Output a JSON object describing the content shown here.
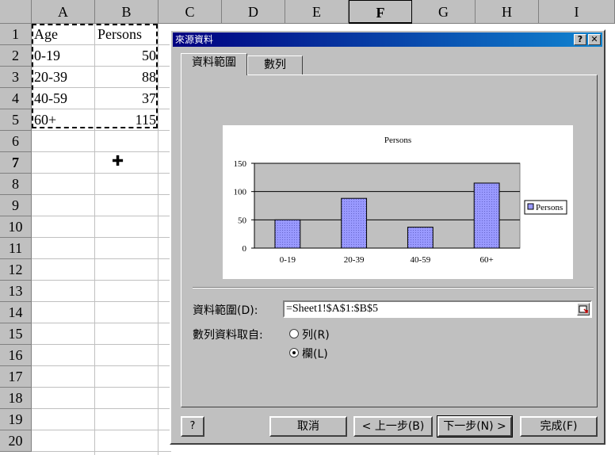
{
  "spreadsheet": {
    "columns": [
      "A",
      "B",
      "C",
      "D",
      "E",
      "F",
      "G",
      "H",
      "I"
    ],
    "active_column": "F",
    "rows": [
      "1",
      "2",
      "3",
      "4",
      "5",
      "6",
      "7",
      "8",
      "9",
      "10",
      "11",
      "12",
      "13",
      "14",
      "15",
      "16",
      "17",
      "18",
      "19",
      "20"
    ],
    "active_row": "7",
    "cells": [
      {
        "a": "Age",
        "b": "Persons"
      },
      {
        "a": "0-19",
        "b": "50"
      },
      {
        "a": "20-39",
        "b": "88"
      },
      {
        "a": "40-59",
        "b": "37"
      },
      {
        "a": "60+",
        "b": "115"
      }
    ]
  },
  "dialog": {
    "title": "來源資料",
    "help_btn": "?",
    "close_btn": "✕",
    "tabs": [
      "資料範圍",
      "數列"
    ],
    "range_label": "資料範圍(D):",
    "range_value": "=Sheet1!$A$1:$B$5",
    "series_from_label": "數列資料取自:",
    "radio_rows": "列(R)",
    "radio_cols": "欄(L)",
    "selected_radio": "cols",
    "buttons": {
      "help": "?",
      "cancel": "取消",
      "back": "< 上一步(B)",
      "next": "下一步(N) >",
      "finish": "完成(F)"
    }
  },
  "chart_data": {
    "type": "bar",
    "title": "Persons",
    "categories": [
      "0-19",
      "20-39",
      "40-59",
      "60+"
    ],
    "series": [
      {
        "name": "Persons",
        "values": [
          50,
          88,
          37,
          115
        ]
      }
    ],
    "ylim": [
      0,
      150
    ],
    "yticks": [
      "0",
      "50",
      "100",
      "150"
    ],
    "grid": true,
    "legend": "right",
    "colors": {
      "bar": "#9999ff",
      "plot_bg": "#c0c0c0"
    }
  }
}
